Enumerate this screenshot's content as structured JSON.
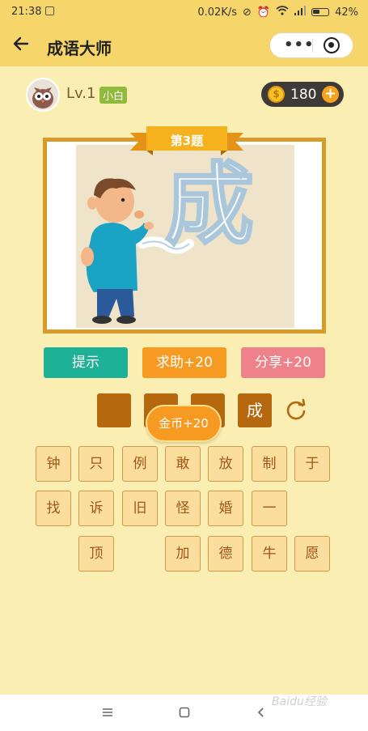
{
  "status_bar": {
    "time": "21:38",
    "network_speed": "0.02K/s",
    "battery": "42%"
  },
  "nav": {
    "title": "成语大师",
    "more_icon": "more-dots-icon",
    "target_icon": "target-icon"
  },
  "user": {
    "level": "Lv.1",
    "badge": "小白",
    "coins": "180",
    "coin_symbol": "$",
    "add_symbol": "+"
  },
  "question": {
    "label": "第3题",
    "picture_text": "成"
  },
  "actions": {
    "hint": "提示",
    "help": "求助+20",
    "share": "分享+20"
  },
  "answer_slots": [
    "",
    "",
    "",
    "成"
  ],
  "toast": "金币+20",
  "keyboard": {
    "row1": [
      "钟",
      "只",
      "例",
      "敢",
      "放",
      "制",
      "于"
    ],
    "row2": [
      "找",
      "诉",
      "旧",
      "怪",
      "婚",
      "一"
    ],
    "row3": [
      "顶",
      "加",
      "德",
      "牛",
      "愿"
    ]
  },
  "watermark": "Baidu经验"
}
